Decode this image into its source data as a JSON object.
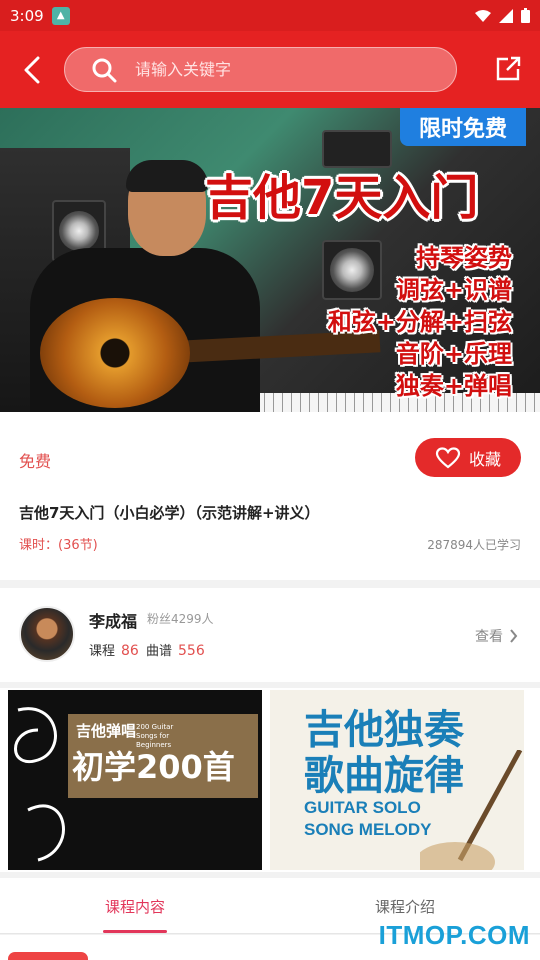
{
  "status_bar": {
    "time": "3:09"
  },
  "header": {
    "search_placeholder": "请输入关键字"
  },
  "banner": {
    "badge": "限时免费",
    "title": "吉他7天入门",
    "lines": [
      "持琴姿势",
      "调弦+识谱",
      "和弦+分解+扫弦",
      "音阶+乐理",
      "独奏+弹唱"
    ]
  },
  "course": {
    "price": "免费",
    "favorite_label": "收藏",
    "title": "吉他7天入门（小白必学）（示范讲解+讲义）",
    "lessons": "课时：(36节)",
    "learners": "287894人已学习"
  },
  "teacher": {
    "name": "李成福",
    "fans": "粉丝4299人",
    "course_label": "课程",
    "course_count": "86",
    "score_label": "曲谱",
    "score_count": "556",
    "view_label": "查看"
  },
  "books": [
    {
      "top": "吉他弹唱",
      "sub": "200 Guitar Songs for Beginners",
      "main": "初学200首"
    },
    {
      "main1": "吉他独奏",
      "main2": "歌曲旋律",
      "en1": "GUITAR SOLO",
      "en2": "SONG MELODY"
    }
  ],
  "tabs": {
    "content": "课程内容",
    "intro": "课程介绍"
  },
  "watermark": "ITMOP.COM",
  "colors": {
    "primary_red": "#e52222",
    "accent_pink": "#e2365a",
    "badge_blue": "#1f7fe0"
  }
}
